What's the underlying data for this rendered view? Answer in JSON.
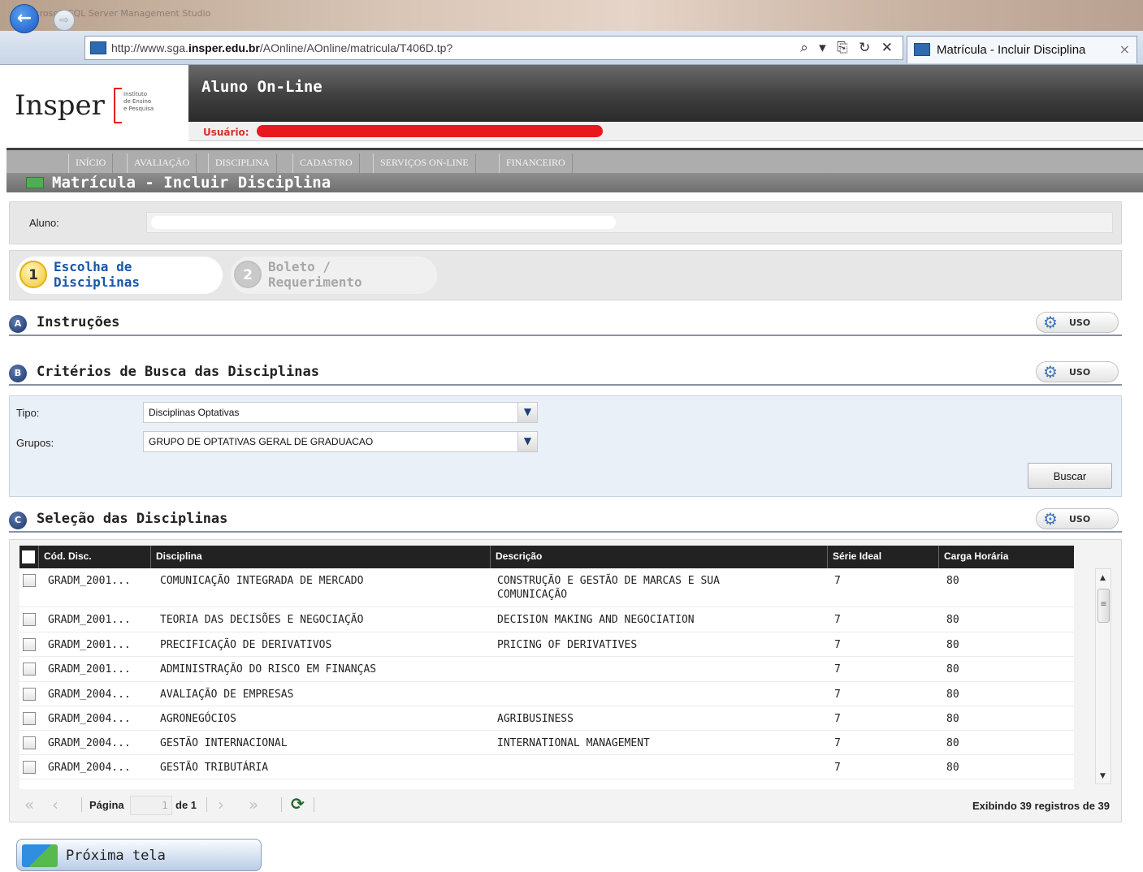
{
  "browser": {
    "window_caption": "Microsoft SQL Server Management Studio",
    "back_label": "←",
    "forward_label": "⇨",
    "url_prefix": "http://www.sga.",
    "url_domain": "insper.edu.br",
    "url_path": "/AOnline/AOnline/matricula/T406D.tp?",
    "url_controls": "⌕ ▾ ⎘ ↻ ✕",
    "tab_title": "Matrícula - Incluir Disciplina",
    "tab_close": "×"
  },
  "header": {
    "logo": "Insper",
    "logo_sub": "Instituto\nde Ensino\ne Pesquisa",
    "app_title": "Aluno On-Line",
    "user_label": "Usuário:"
  },
  "nav": {
    "items": [
      "INÍCIO",
      "AVALIAÇÃO",
      "DISCIPLINA",
      "CADASTRO",
      "SERVIÇOS ON-LINE",
      "FINANCEIRO"
    ]
  },
  "page": {
    "title": "Matrícula - Incluir Disciplina",
    "aluno_label": "Aluno:"
  },
  "steps": [
    {
      "num": "1",
      "label": "Escolha de Disciplinas",
      "line1": "Escolha de",
      "line2": "Disciplinas"
    },
    {
      "num": "2",
      "label": "Boleto / Requerimento",
      "line1": "Boleto /",
      "line2": "Requerimento"
    }
  ],
  "sections": {
    "a": {
      "badge": "A",
      "title": "Instruções",
      "uso": "USO"
    },
    "b": {
      "badge": "B",
      "title": "Critérios de Busca das Disciplinas",
      "uso": "USO"
    },
    "c": {
      "badge": "C",
      "title": "Seleção das Disciplinas",
      "uso": "USO"
    }
  },
  "filters": {
    "tipo_label": "Tipo:",
    "tipo_value": "Disciplinas Optativas",
    "grupos_label": "Grupos:",
    "grupos_value": "GRUPO DE OPTATIVAS GERAL DE GRADUACAO",
    "search_label": "Buscar"
  },
  "table": {
    "columns": [
      "Cód. Disc.",
      "Disciplina",
      "Descrição",
      "Série Ideal",
      "Carga Horária"
    ],
    "rows": [
      {
        "cod": "GRADM_2001...",
        "disc": "COMUNICAÇÃO INTEGRADA DE MERCADO",
        "desc": "CONSTRUÇÃO E GESTÃO DE MARCAS E SUA\nCOMUNICAÇÃO",
        "serie": "7",
        "carga": "80"
      },
      {
        "cod": "GRADM_2001...",
        "disc": "TEORIA DAS DECISÕES E NEGOCIAÇÃO",
        "desc": "DECISION MAKING AND NEGOCIATION",
        "serie": "7",
        "carga": "80"
      },
      {
        "cod": "GRADM_2001...",
        "disc": "PRECIFICAÇÃO DE DERIVATIVOS",
        "desc": "PRICING OF DERIVATIVES",
        "serie": "7",
        "carga": "80"
      },
      {
        "cod": "GRADM_2001...",
        "disc": "ADMINISTRAÇÃO DO RISCO EM FINANÇAS",
        "desc": "",
        "serie": "7",
        "carga": "80"
      },
      {
        "cod": "GRADM_2004...",
        "disc": "AVALIAÇÃO DE EMPRESAS",
        "desc": "",
        "serie": "7",
        "carga": "80"
      },
      {
        "cod": "GRADM_2004...",
        "disc": "AGRONEGÓCIOS",
        "desc": "AGRIBUSINESS",
        "serie": "7",
        "carga": "80"
      },
      {
        "cod": "GRADM_2004...",
        "disc": "GESTÃO INTERNACIONAL",
        "desc": "INTERNATIONAL MANAGEMENT",
        "serie": "7",
        "carga": "80"
      },
      {
        "cod": "GRADM_2004...",
        "disc": "GESTÃO TRIBUTÁRIA",
        "desc": "",
        "serie": "7",
        "carga": "80"
      }
    ]
  },
  "pager": {
    "page_label": "Página",
    "page_value": "1",
    "of_label": "de 1",
    "summary": "Exibindo 39 registros de 39"
  },
  "footer": {
    "next_label": "Próxima tela"
  }
}
